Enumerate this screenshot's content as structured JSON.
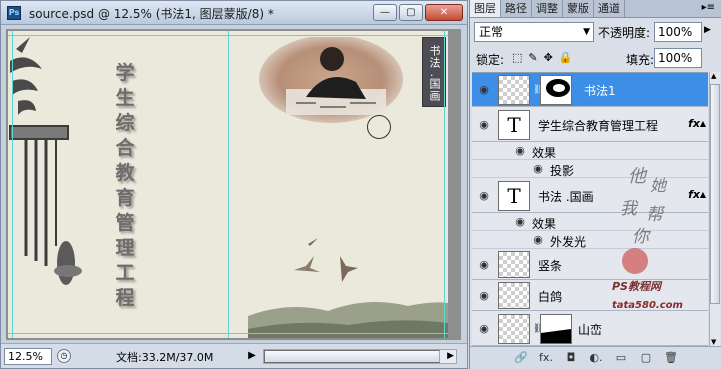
{
  "document": {
    "title": "source.psd @ 12.5% (书法1, 图层蒙版/8) *",
    "app_badge": "Ps",
    "window_buttons": {
      "minimize": "—",
      "restore": "▢",
      "close": "✕"
    },
    "vertical_title_chars": [
      "学",
      "生",
      "综",
      "合",
      "教",
      "育",
      "管",
      "理",
      "工",
      "程"
    ],
    "seal_text": "书法 .国画",
    "zoom": "12.5%",
    "doc_info": "文档:33.2M/37.0M",
    "play_glyph": "▶"
  },
  "panel": {
    "tabs": [
      {
        "label": "图层"
      },
      {
        "label": "路径"
      },
      {
        "label": "调整"
      },
      {
        "label": "蒙版"
      },
      {
        "label": "通道"
      }
    ],
    "menu_glyph": "▸≡",
    "blend_mode": "正常",
    "opacity_label": "不透明度:",
    "opacity_value": "100%",
    "lock_label": "锁定:",
    "lock_icons": [
      "⬚",
      "✎",
      "✥",
      "🔒"
    ],
    "fill_label": "填充:",
    "fill_value": "100%",
    "layers": [
      {
        "name": "书法1",
        "type": "raster-mask",
        "selected": true
      },
      {
        "name": "学生综合教育管理工程",
        "type": "text",
        "fx": "fx",
        "effect_label": "效果",
        "effect": "投影"
      },
      {
        "name": "书法 .国画",
        "type": "text",
        "fx": "fx",
        "effect_label": "效果",
        "effect": "外发光"
      },
      {
        "name": "竖条",
        "type": "raster"
      },
      {
        "name": "白鸽",
        "type": "raster"
      },
      {
        "name": "山峦",
        "type": "raster-mask"
      }
    ],
    "bottom_icons": [
      "🔗",
      "fx.",
      "◘",
      "◐.",
      "▭",
      "▢",
      "🗑"
    ]
  },
  "watermark": {
    "handwriting": [
      "他",
      "她",
      "我",
      "帮",
      "你"
    ],
    "brand": "PS教程网",
    "url": "tata580.com"
  },
  "colors": {
    "selected_layer": "#3d8ee6",
    "canvas_bg": "#ebe8dc",
    "guide": "#5fd6d6"
  }
}
